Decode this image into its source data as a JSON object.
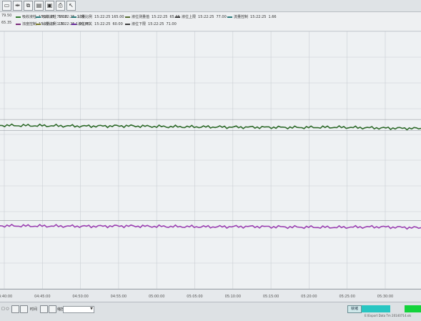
{
  "toolbar": {
    "buttons": [
      {
        "name": "layout-icon",
        "glyph": "▭"
      },
      {
        "name": "fit-icon",
        "glyph": "⇹"
      },
      {
        "name": "copy-icon",
        "glyph": "⧉"
      },
      {
        "name": "paste-icon",
        "glyph": "▤"
      },
      {
        "name": "lock-icon",
        "glyph": "▣"
      },
      {
        "name": "print-icon",
        "glyph": "⎙"
      },
      {
        "name": "pointer-icon",
        "glyph": "↖"
      }
    ]
  },
  "legend": {
    "left_values": [
      "79.50",
      "65.35"
    ],
    "row1": [
      {
        "color": "#2f7a2a",
        "label": "吸收液柱",
        "time": "15:22:25",
        "value": "79.00"
      },
      {
        "color": "#2a7a7a",
        "label": "吸收液柱",
        "time": "15:22:25",
        "value": "1.30"
      },
      {
        "color": "#2a7a7a",
        "label": "计量比例",
        "time": "15:22:25 165.00",
        "value": ""
      },
      {
        "color": "#556b2f",
        "label": "液位测量值",
        "time": "15:22:25",
        "value": "65.35"
      },
      {
        "color": "#3b3b3b",
        "label": "液位上限",
        "time": "15:22:25",
        "value": "77.00"
      },
      {
        "color": "#2a7a7a",
        "label": "流量控制",
        "time": "15:22:25",
        "value": "1.66"
      }
    ],
    "row2": [
      {
        "color": "#7a2a7a",
        "label": "浓度控制",
        "time": "15:22:25",
        "value": "1.30"
      },
      {
        "color": "#7a7a2a",
        "label": "计量比例",
        "time": "15:22:25 1.00.00",
        "value": ""
      },
      {
        "color": "#6a2aa0",
        "label": "液位开关",
        "time": "15:22:25",
        "value": "60.00"
      },
      {
        "color": "#3b3b3b",
        "label": "液位下限",
        "time": "15:22:25",
        "value": "71.00"
      }
    ]
  },
  "chart_data": {
    "type": "line",
    "x_ticks": [
      "04:40:00",
      "04:45:00",
      "04:50:00",
      "04:55:00",
      "05:00:00",
      "05:05:00",
      "05:10:00",
      "05:15:00",
      "05:20:00",
      "05:25:00",
      "05:30:00"
    ],
    "ylim": [
      0,
      100
    ],
    "series": [
      {
        "color": "#2e6a2a",
        "values": [
          63.5,
          63.4,
          63.2,
          63.3,
          63.0,
          62.9,
          62.8,
          62.7,
          62.8,
          62.5,
          62.3
        ]
      },
      {
        "color": "#9a3fb0",
        "values": [
          24.5,
          24.4,
          24.3,
          24.4,
          24.2,
          24.1,
          24.2,
          24.0,
          23.9,
          24.1,
          23.7
        ]
      }
    ],
    "ref_lines": [
      65.8,
      61.6,
      26.5
    ],
    "grid": true
  },
  "bottom": {
    "zoom_label": "□ ○",
    "select_label": "缩放",
    "time_label": "时间",
    "status_button": "就绪",
    "path": "E:\\Export Data Tm 20140714.xls"
  }
}
